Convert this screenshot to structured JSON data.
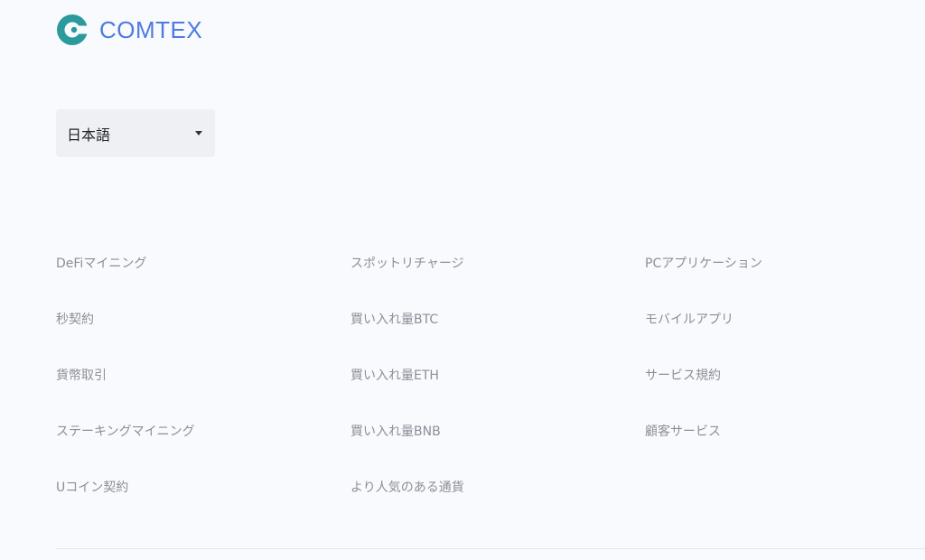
{
  "brand": {
    "name": "COMTEX",
    "color": "#4d7be0",
    "logo_color": "#2a9a9c"
  },
  "language_select": {
    "selected": "日本語"
  },
  "footer": {
    "columns": [
      {
        "links": [
          "DeFiマイニング",
          "秒契約",
          "貨幣取引",
          "ステーキングマイニング",
          "Uコイン契約"
        ]
      },
      {
        "links": [
          "スポットリチャージ",
          "買い入れ量BTC",
          "買い入れ量ETH",
          "買い入れ量BNB",
          "より人気のある通貨"
        ]
      },
      {
        "links": [
          "PCアプリケーション",
          "モバイルアプリ",
          "サービス規約",
          "顧客サービス"
        ]
      }
    ]
  }
}
